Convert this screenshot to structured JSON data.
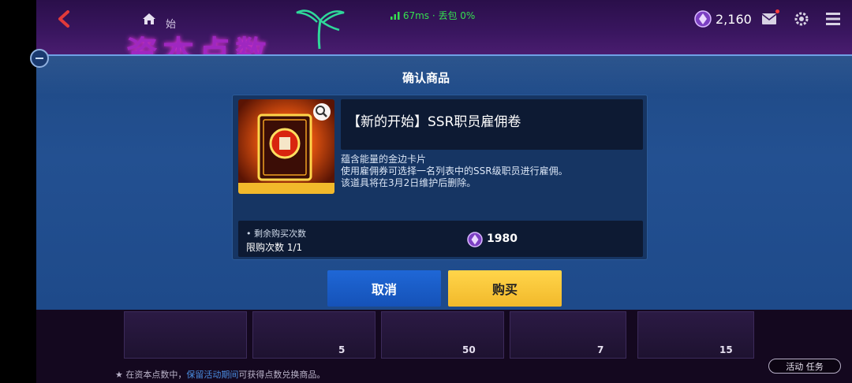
{
  "topbar": {
    "home_label": "始",
    "bg_title": "资本点数",
    "network": "67ms · 丢包 0%",
    "currency_value": "2,160"
  },
  "modal": {
    "title": "确认商品",
    "item_name": "【新的开始】SSR职员雇佣卷",
    "description": [
      "蕴含能量的金边卡片",
      "使用雇佣券可选择一名列表中的SSR级职员进行雇佣。",
      "该道具将在3月2日维护后删除。"
    ],
    "remain_label": "• 剩余购买次数",
    "limit_label": "限购次数  1/1",
    "price": "1980",
    "cancel_label": "取消",
    "buy_label": "购买"
  },
  "shop": {
    "slot_counts": [
      "5",
      "50",
      "7",
      "15"
    ],
    "hint_prefix": "★ 在资本点数中，",
    "hint_link": "保留活动期间",
    "hint_suffix": "可获得点数兑换商品。",
    "tab_label": "活动  任务"
  },
  "colors": {
    "accent_blue": "#1f67d6",
    "accent_yellow": "#f2b92b",
    "panel": "#163563",
    "band": "#235091"
  }
}
